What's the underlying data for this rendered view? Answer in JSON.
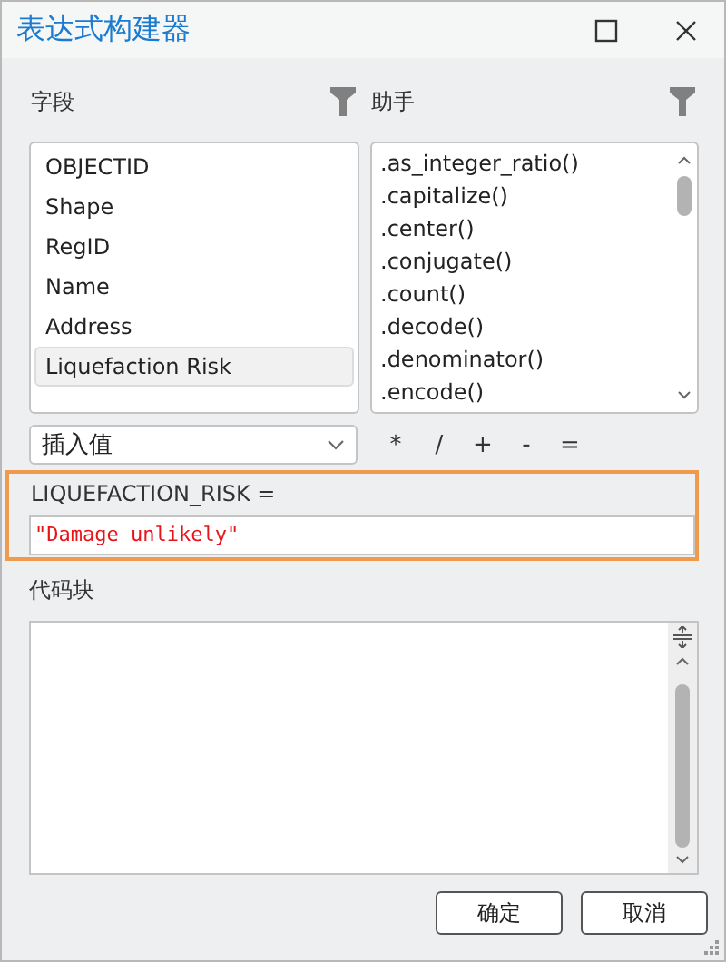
{
  "window": {
    "title": "表达式构建器"
  },
  "fields": {
    "label": "字段",
    "items": [
      {
        "label": "OBJECTID",
        "selected": false
      },
      {
        "label": "Shape",
        "selected": false
      },
      {
        "label": "RegID",
        "selected": false
      },
      {
        "label": "Name",
        "selected": false
      },
      {
        "label": "Address",
        "selected": false
      },
      {
        "label": "Liquefaction Risk",
        "selected": true
      }
    ]
  },
  "helpers": {
    "label": "助手",
    "items": [
      ".as_integer_ratio()",
      ".capitalize()",
      ".center()",
      ".conjugate()",
      ".count()",
      ".decode()",
      ".denominator()",
      ".encode()"
    ]
  },
  "insert_dropdown": {
    "value": "插入值"
  },
  "operators": [
    "*",
    "/",
    "+",
    "-",
    "="
  ],
  "expression": {
    "label": "LIQUEFACTION_RISK =",
    "value": "\"Damage unlikely\""
  },
  "code_block": {
    "label": "代码块"
  },
  "buttons": [
    "确定",
    "取消"
  ]
}
